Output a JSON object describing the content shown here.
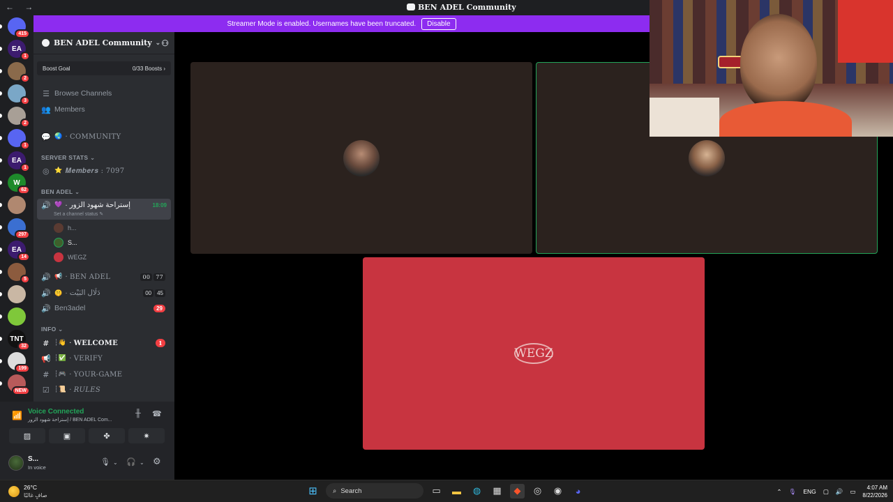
{
  "window": {
    "nav": "← →",
    "title": "BEN ADEL Community"
  },
  "banner": {
    "text": "Streamer Mode is enabled. Usernames have been truncated.",
    "disable_label": "Disable"
  },
  "servers": [
    {
      "label": "",
      "badge": "415",
      "color": "#5865f2"
    },
    {
      "label": "EA",
      "badge": "1",
      "color": "#3c1b6e"
    },
    {
      "label": "",
      "badge": "2",
      "color": "#8a6a4b"
    },
    {
      "label": "",
      "badge": "3",
      "color": "#7aa7c7"
    },
    {
      "label": "",
      "badge": "2",
      "color": "#a89f96"
    },
    {
      "label": "",
      "badge": "1",
      "color": "#5865f2"
    },
    {
      "label": "EA",
      "badge": "1",
      "color": "#3c1b6e"
    },
    {
      "label": "W",
      "badge": "62",
      "color": "#1e8a2b"
    },
    {
      "label": "",
      "badge": "",
      "color": "#b08870"
    },
    {
      "label": "",
      "badge": "297",
      "color": "#3b6fd1"
    },
    {
      "label": "EA",
      "badge": "14",
      "color": "#3c1b6e"
    },
    {
      "label": "",
      "badge": "5",
      "color": "#8c5b3e"
    },
    {
      "label": "",
      "badge": "",
      "color": "#c9b7a4"
    },
    {
      "label": "",
      "badge": "",
      "color": "#7fc83a"
    },
    {
      "label": "TNT",
      "badge": "32",
      "color": "#111111"
    },
    {
      "label": "",
      "badge": "199",
      "color": "#dddddd"
    },
    {
      "label": "",
      "badge": "NEW",
      "color": "#b85a5a"
    }
  ],
  "sidebar": {
    "server_name": "BEN ADEL Community",
    "boost_goal": "Boost Goal",
    "boost_count": "0/33 Boosts",
    "browse_channels": "Browse Channels",
    "members": "Members",
    "community": "COMMUNITY",
    "cat_server_stats": "SERVER STATS",
    "members_stat": "𝑴𝒆𝒎𝒃𝒆𝒓𝒔 : 7097",
    "cat_ben_adel": "BEN ADEL",
    "active_channel": "إستراحة شهود الزور",
    "active_time": "18:09",
    "channel_status": "Set a channel status",
    "voice_users": [
      "h...",
      "S...",
      "WEGZ"
    ],
    "ch_ben_adel": "BEN ADEL",
    "ch_ben_adel_pill": [
      "00",
      "77"
    ],
    "ch_dalal": "دَلَال البَيْت",
    "ch_dalal_pill": [
      "00",
      "45"
    ],
    "ch_ben3adel": "Ben3adel",
    "ch_ben3adel_badge": "29",
    "cat_info": "INFO",
    "ch_welcome": "WELCOME",
    "ch_welcome_badge": "1",
    "ch_verify": "VERIFY",
    "ch_your_game": "YOUR-GAME",
    "ch_rules": "RULES"
  },
  "voice": {
    "title": "Voice Connected",
    "subtitle": "إستراحة شهود الزور / BEN ADEL Com..."
  },
  "user": {
    "name": "S...",
    "status": "In voice"
  },
  "stage": {
    "tile_wegz_label": "WEGZ"
  },
  "taskbar": {
    "temp": "26°C",
    "weather": "صافٍ غالبًا",
    "search": "Search",
    "lang": "ENG",
    "time": "4:07 AM",
    "date": "8/22/2026"
  },
  "colors": {
    "accent": "#8d2cf0",
    "voice_green": "#23a559",
    "badge_red": "#f23f43",
    "tile_red": "#c83440"
  }
}
